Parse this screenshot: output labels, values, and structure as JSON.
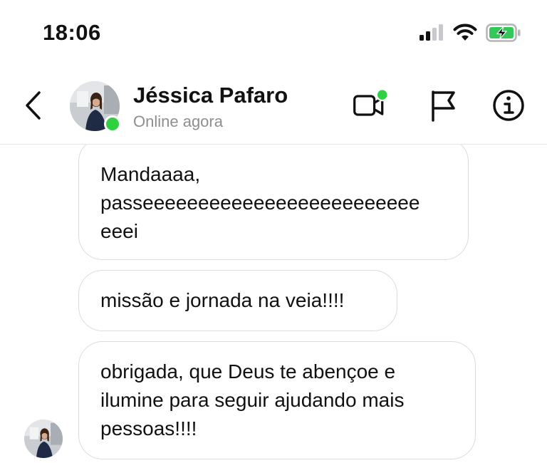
{
  "status_bar": {
    "time": "18:06",
    "signal_icon": "cellular-signal-icon",
    "wifi_icon": "wifi-icon",
    "battery_icon": "battery-charging-icon",
    "battery_color": "#34c759"
  },
  "header": {
    "back_icon": "chevron-left-icon",
    "contact_name": "Jéssica Pafaro",
    "contact_status": "Online agora",
    "online_color": "#2fd041",
    "actions": {
      "video_icon": "video-call-icon",
      "report_icon": "flag-icon",
      "info_icon": "info-icon"
    }
  },
  "messages": [
    {
      "sender": "Jéssica Pafaro",
      "text": "Mandaaaa,\npasseeeeeeeeeeeeeeeeeeeeeeeee\neeei"
    },
    {
      "sender": "Jéssica Pafaro",
      "text": "missão e jornada na veia!!!!"
    },
    {
      "sender": "Jéssica Pafaro",
      "text": "obrigada, que Deus te abençoe e\nilumine para seguir ajudando mais\npessoas!!!!"
    }
  ]
}
